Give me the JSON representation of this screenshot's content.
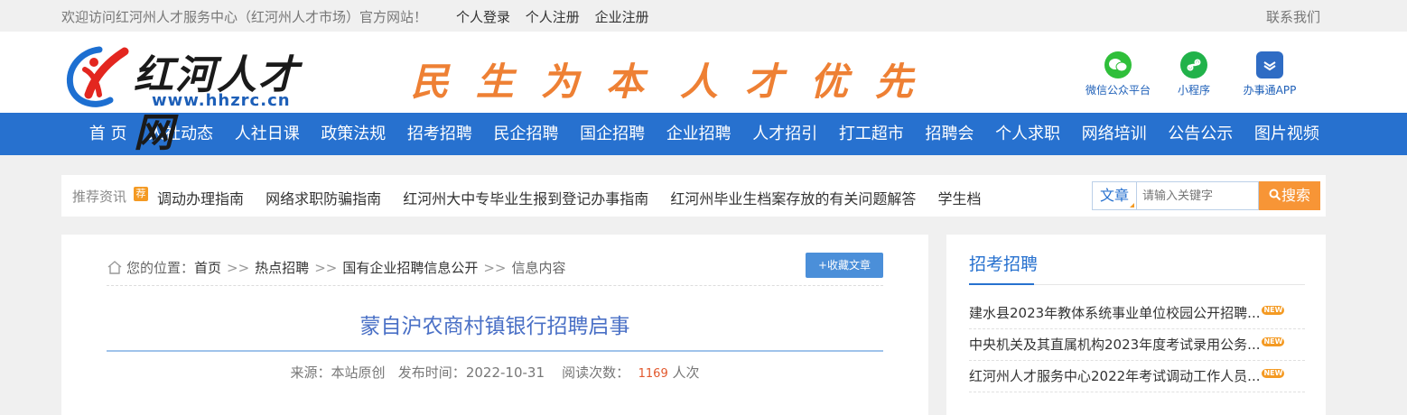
{
  "topbar": {
    "welcome": "欢迎访问红河州人才服务中心（红河州人才市场）官方网站！",
    "links": [
      "个人登录",
      "个人注册",
      "企业注册"
    ],
    "contact": "联系我们"
  },
  "header": {
    "logo_name": "红河人才网",
    "logo_url": "www.hhzrc.cn",
    "slogan_left": "民生为本",
    "slogan_right": "人才优先",
    "quick_icons": [
      {
        "label": "微信公众平台",
        "icon": "wechat-icon"
      },
      {
        "label": "小程序",
        "icon": "mini-program-icon"
      },
      {
        "label": "办事通APP",
        "icon": "app-icon"
      }
    ]
  },
  "nav": [
    "首 页",
    "人社动态",
    "人社日课",
    "政策法规",
    "招考招聘",
    "民企招聘",
    "国企招聘",
    "企业招聘",
    "人才招引",
    "打工超市",
    "招聘会",
    "个人求职",
    "网络培训",
    "公告公示",
    "图片视频"
  ],
  "recommend": {
    "label": "推荐资讯",
    "hot": "荐",
    "items": [
      "调动办理指南",
      "网络求职防骗指南",
      "红河州大中专毕业生报到登记办事指南",
      "红河州毕业生档案存放的有关问题解答",
      "学生档"
    ]
  },
  "search": {
    "type": "文章",
    "placeholder": "请输入关键字",
    "button": "搜索"
  },
  "article": {
    "breadcrumb_prefix": "您的位置：",
    "breadcrumb": [
      "首页",
      "热点招聘",
      "国有企业招聘信息公开",
      "信息内容"
    ],
    "sep": ">>",
    "favorite": "+收藏文章",
    "title": "蒙自沪农商村镇银行招聘启事",
    "source_label": "来源：",
    "source": "本站原创",
    "time_label": "发布时间：",
    "time": "2022-10-31",
    "views_label": "阅读次数：",
    "views": "1169",
    "views_unit": "人次"
  },
  "sidebar": {
    "title": "招考招聘",
    "new_badge": "NEW",
    "items": [
      "建水县2023年教体系统事业单位校园公开招聘...",
      "中央机关及其直属机构2023年度考试录用公务...",
      "红河州人才服务中心2022年考试调动工作人员..."
    ]
  },
  "colors": {
    "nav_bg": "#2771cf",
    "slogan": "#ee8034",
    "search_btn": "#f79536",
    "title": "#4a70c6"
  }
}
